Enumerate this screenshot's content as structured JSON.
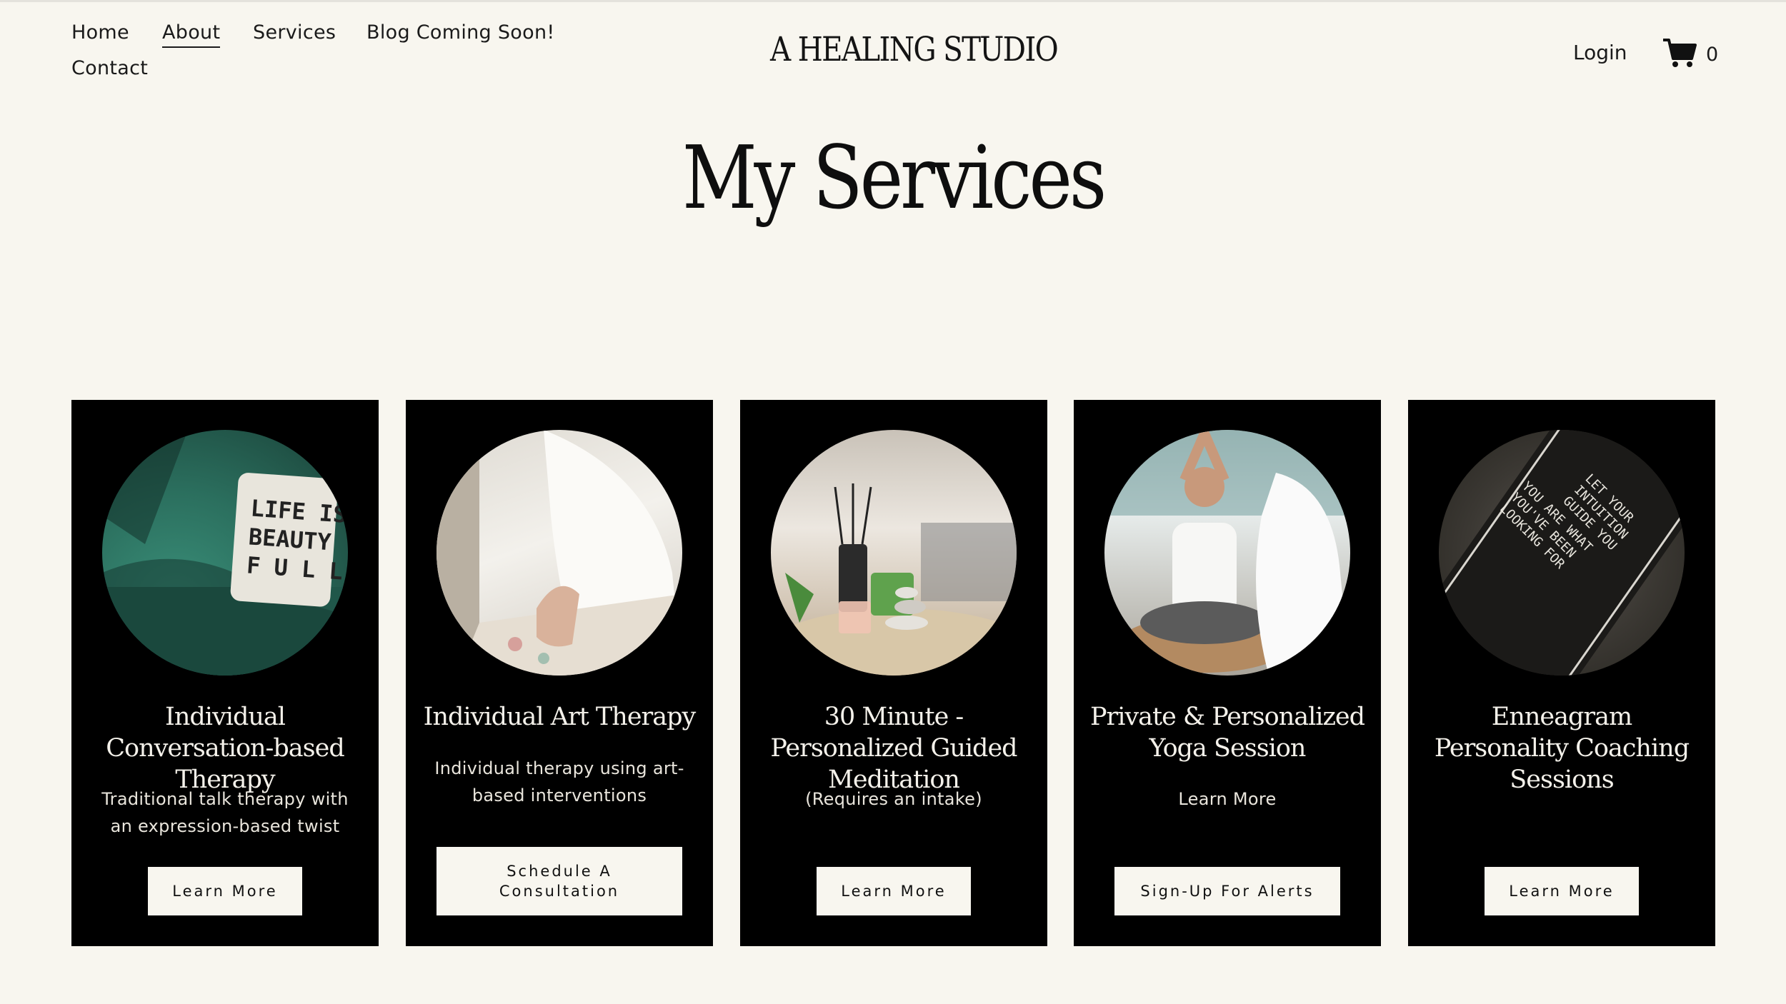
{
  "nav": {
    "items": [
      {
        "label": "Home",
        "active": false
      },
      {
        "label": "About",
        "active": true
      },
      {
        "label": "Services",
        "active": false
      },
      {
        "label": "Blog Coming Soon!",
        "active": false
      },
      {
        "label": "Contact",
        "active": false
      }
    ]
  },
  "brand": "A HEALING STUDIO",
  "header": {
    "login_label": "Login",
    "cart_count": "0"
  },
  "page_title": "My Services",
  "cards": [
    {
      "title": "Individual Conversation-based Therapy",
      "description": "Traditional talk therapy with an expression-based twist",
      "button": "Learn More",
      "photo_text": "LIFE IS BEAUTY FULL"
    },
    {
      "title": "Individual Art Therapy",
      "description": "Individual therapy using art-based interventions",
      "button": "Schedule A Consultation"
    },
    {
      "title": "30 Minute - Personalized Guided Meditation",
      "description": "(Requires an intake)",
      "button": "Learn More"
    },
    {
      "title": "Private & Personalized Yoga Session",
      "description": "Learn More",
      "button": "Sign-Up For Alerts"
    },
    {
      "title": "Enneagram Personality Coaching Sessions",
      "description": "",
      "button": "Learn More",
      "photo_text": "LET YOUR INTUITION GUIDE YOU YOU ARE WHAT YOU'VE BEEN LOOKING FOR"
    }
  ],
  "colors": {
    "background": "#f8f6ef",
    "card": "#000000",
    "button": "#f8f6ef"
  }
}
